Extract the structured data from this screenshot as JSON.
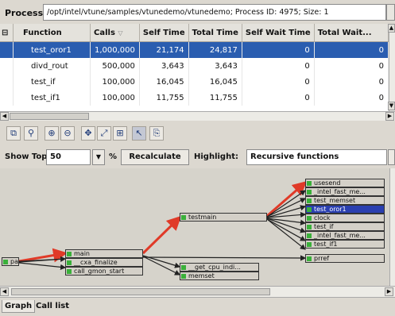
{
  "process": {
    "label": "Process:",
    "path": "/opt/intel/vtune/samples/vtunedemo/vtunedemo; Process ID: 4975; Size: 1"
  },
  "table": {
    "columns": [
      "Function",
      "Calls",
      "Self Time",
      "Total Time",
      "Self Wait Time",
      "Total Wait..."
    ],
    "sort_indicator": "▽",
    "rows": [
      {
        "function": "test_oror1",
        "calls": "1,000,000",
        "self_time": "21,174",
        "total_time": "24,817",
        "self_wait": "0",
        "total_wait": "0",
        "selected": true
      },
      {
        "function": "divd_rout",
        "calls": "500,000",
        "self_time": "3,643",
        "total_time": "3,643",
        "self_wait": "0",
        "total_wait": "0"
      },
      {
        "function": "test_if",
        "calls": "100,000",
        "self_time": "16,045",
        "total_time": "16,045",
        "self_wait": "0",
        "total_wait": "0"
      },
      {
        "function": "test_if1",
        "calls": "100,000",
        "self_time": "11,755",
        "total_time": "11,755",
        "self_wait": "0",
        "total_wait": "0"
      }
    ]
  },
  "toolbar": {
    "icons": [
      "select-region-icon",
      "search-icon",
      "zoom-in-icon",
      "zoom-out-icon",
      "pan-icon",
      "fit-icon",
      "layout-icon",
      "pointer-icon",
      "export-icon"
    ]
  },
  "controls": {
    "show_top_label": "Show Top:",
    "show_top_value": "50",
    "percent_label": "%",
    "recalculate_label": "Recalculate",
    "highlight_label": "Highlight:",
    "highlight_value": "Recursive functions"
  },
  "graph": {
    "nodes": {
      "root": "pac",
      "main": "main",
      "cxa_finalize": "__cxa_finalize",
      "call_gmon_start": "call_gmon_start",
      "testmain": "testmain",
      "get_cpu_indi": "__get_cpu_indi...",
      "memset": "memset",
      "usesend": "usesend",
      "intel_fast_me1": "_intel_fast_me...",
      "test_memset": "test_memset",
      "test_oror1": "test_oror1",
      "clock": "clock",
      "test_if": "test_if",
      "intel_fast_me2": "_intel_fast_me...",
      "test_if1": "test_if1",
      "prref": "prref"
    },
    "colors": {
      "hot_edge": "#e03a28",
      "edge": "#222222",
      "selected_node": "#2a3fb0",
      "node_marker": "#3ab03a"
    }
  },
  "tabs": [
    {
      "label": "Graph",
      "active": true
    },
    {
      "label": "Call list",
      "active": false
    }
  ]
}
